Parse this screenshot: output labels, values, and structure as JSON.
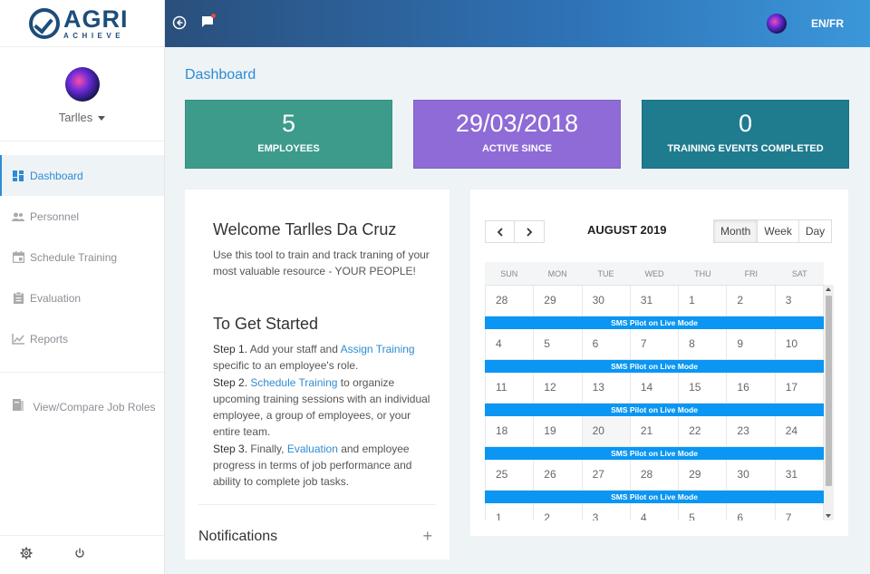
{
  "app": {
    "logo_main": "AGRI",
    "logo_sub": "ACHIEVE"
  },
  "user": {
    "name": "Tarlles"
  },
  "sidebar": {
    "items": [
      {
        "label": "Dashboard",
        "icon": "dashboard-icon",
        "active": true
      },
      {
        "label": "Personnel",
        "icon": "people-icon"
      },
      {
        "label": "Schedule Training",
        "icon": "calendar-icon"
      },
      {
        "label": "Evaluation",
        "icon": "clipboard-icon"
      },
      {
        "label": "Reports",
        "icon": "chart-icon"
      }
    ],
    "secondary": {
      "label": "View/Compare Job Roles",
      "icon": "book-icon"
    }
  },
  "topbar": {
    "lang": "EN/FR"
  },
  "breadcrumb": "Dashboard",
  "stats": [
    {
      "value": "5",
      "label": "EMPLOYEES",
      "color": "#3d9b8c"
    },
    {
      "value": "29/03/2018",
      "label": "ACTIVE SINCE",
      "color": "#8e6bd6"
    },
    {
      "value": "0",
      "label": "TRAINING EVENTS COMPLETED",
      "color": "#1f7b8e"
    }
  ],
  "welcome": {
    "title": "Welcome Tarlles Da Cruz",
    "lead": "Use this tool to train and track traning of your most valuable resource - YOUR PEOPLE!",
    "started_title": "To Get Started",
    "step1_label": "Step 1.",
    "step1_pre": " Add your staff and ",
    "step1_link": "Assign Training",
    "step1_post": " specific to an employee's role.",
    "step2_label": "Step 2.",
    "step2_link": "Schedule Training",
    "step2_post": " to organize upcoming training sessions with an individual employee, a group of employees, or your entire team.",
    "step3_label": "Step 3.",
    "step3_pre": " Finally, ",
    "step3_link": "Evaluation",
    "step3_post": " and employee progress in terms of job performance and ability to complete job tasks."
  },
  "notifications": {
    "title": "Notifications",
    "toggle": "+"
  },
  "calendar": {
    "title": "AUGUST 2019",
    "views": [
      "Month",
      "Week",
      "Day"
    ],
    "active_view": "Month",
    "days_of_week": [
      "SUN",
      "MON",
      "TUE",
      "WED",
      "THU",
      "FRI",
      "SAT"
    ],
    "weeks": [
      [
        "28",
        "29",
        "30",
        "31",
        "1",
        "2",
        "3"
      ],
      [
        "4",
        "5",
        "6",
        "7",
        "8",
        "9",
        "10"
      ],
      [
        "11",
        "12",
        "13",
        "14",
        "15",
        "16",
        "17"
      ],
      [
        "18",
        "19",
        "20",
        "21",
        "22",
        "23",
        "24"
      ],
      [
        "25",
        "26",
        "27",
        "28",
        "29",
        "30",
        "31"
      ],
      [
        "1",
        "2",
        "3",
        "4",
        "5",
        "6",
        "7"
      ]
    ],
    "today": "20",
    "event_title": "SMS Pilot on Live Mode"
  }
}
